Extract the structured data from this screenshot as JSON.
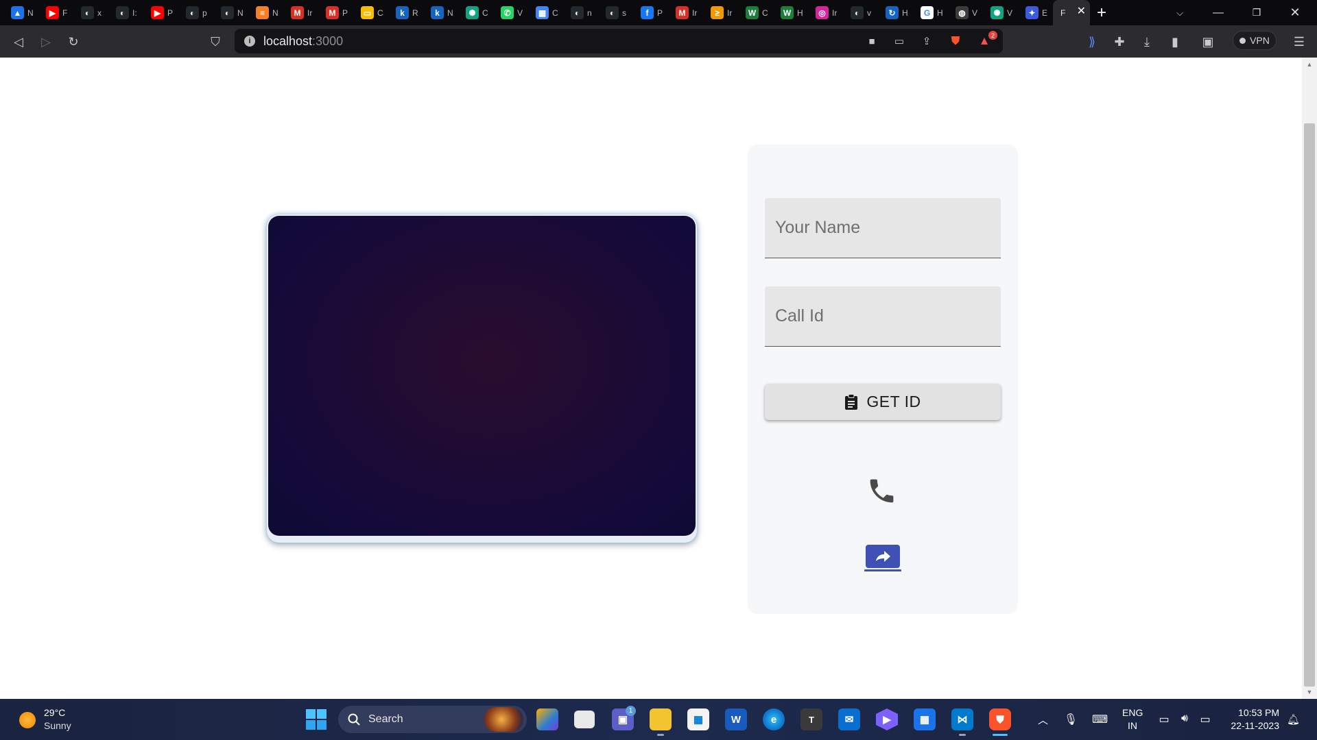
{
  "browser": {
    "tabs": [
      {
        "icon": "google-drive-icon",
        "color": "#1a73e8",
        "glyph": "▲",
        "label": "N"
      },
      {
        "icon": "youtube-icon",
        "color": "#ff0000",
        "glyph": "▶",
        "label": "F"
      },
      {
        "icon": "github-icon",
        "color": "#24292e",
        "glyph": "◐",
        "label": "x"
      },
      {
        "icon": "github-icon",
        "color": "#24292e",
        "glyph": "◐",
        "label": "I:"
      },
      {
        "icon": "youtube-icon",
        "color": "#ff0000",
        "glyph": "▶",
        "label": "P"
      },
      {
        "icon": "github-icon",
        "color": "#24292e",
        "glyph": "◐",
        "label": "p"
      },
      {
        "icon": "github-icon",
        "color": "#24292e",
        "glyph": "◐",
        "label": "N"
      },
      {
        "icon": "stackoverflow-icon",
        "color": "#f48024",
        "glyph": "≡",
        "label": "N"
      },
      {
        "icon": "gmail-icon",
        "color": "#d93025",
        "glyph": "M",
        "label": "Ir"
      },
      {
        "icon": "gmail-icon",
        "color": "#d93025",
        "glyph": "M",
        "label": "P"
      },
      {
        "icon": "google-slides-icon",
        "color": "#fbbc04",
        "glyph": "▭",
        "label": "C"
      },
      {
        "icon": "k-icon",
        "color": "#1565c0",
        "glyph": "k",
        "label": "R"
      },
      {
        "icon": "k-icon",
        "color": "#1565c0",
        "glyph": "k",
        "label": "N"
      },
      {
        "icon": "chatgpt-icon",
        "color": "#10a37f",
        "glyph": "✺",
        "label": "C"
      },
      {
        "icon": "whatsapp-icon",
        "color": "#25d366",
        "glyph": "✆",
        "label": "V"
      },
      {
        "icon": "calendar-icon",
        "color": "#4285f4",
        "glyph": "▦",
        "label": "C"
      },
      {
        "icon": "github-icon",
        "color": "#24292e",
        "glyph": "◐",
        "label": "n"
      },
      {
        "icon": "github-icon",
        "color": "#24292e",
        "glyph": "◐",
        "label": "s"
      },
      {
        "icon": "facebook-icon",
        "color": "#1877f2",
        "glyph": "f",
        "label": "P"
      },
      {
        "icon": "gmail-icon",
        "color": "#d93025",
        "glyph": "M",
        "label": "Ir"
      },
      {
        "icon": "stream-icon",
        "color": "#f29900",
        "glyph": "≥",
        "label": "Ir"
      },
      {
        "icon": "w-icon",
        "color": "#1b7f3b",
        "glyph": "W",
        "label": "C"
      },
      {
        "icon": "w-icon",
        "color": "#1b7f3b",
        "glyph": "W",
        "label": "H"
      },
      {
        "icon": "instagram-icon",
        "color": "#d6249f",
        "glyph": "◎",
        "label": "Ir"
      },
      {
        "icon": "github-icon",
        "color": "#24292e",
        "glyph": "◐",
        "label": "v"
      },
      {
        "icon": "loop-icon",
        "color": "#1565c0",
        "glyph": "↻",
        "label": "H"
      },
      {
        "icon": "google-icon",
        "color": "#ffffff",
        "glyph": "G",
        "label": "H"
      },
      {
        "icon": "globe-icon",
        "color": "#3c3c3c",
        "glyph": "◍",
        "label": "V"
      },
      {
        "icon": "chatgpt-icon",
        "color": "#10a37f",
        "glyph": "✺",
        "label": "V"
      },
      {
        "icon": "gemini-icon",
        "color": "#3b5bdb",
        "glyph": "✦",
        "label": "E"
      }
    ],
    "active_tab_label": "F",
    "url_host": "localhost",
    "url_port": ":3000",
    "vpn_label": "VPN",
    "brave_badge": "2"
  },
  "app": {
    "name_placeholder": "Your Name",
    "callid_placeholder": "Call Id",
    "getid_label": "GET ID",
    "accent_color": "#3f51b5",
    "panel_bg": "#f6f7f9"
  },
  "taskbar": {
    "temperature": "29°C",
    "condition": "Sunny",
    "search_label": "Search",
    "lang_line1": "ENG",
    "lang_line2": "IN",
    "time": "10:53 PM",
    "date": "22-11-2023",
    "teams_badge": "1"
  }
}
